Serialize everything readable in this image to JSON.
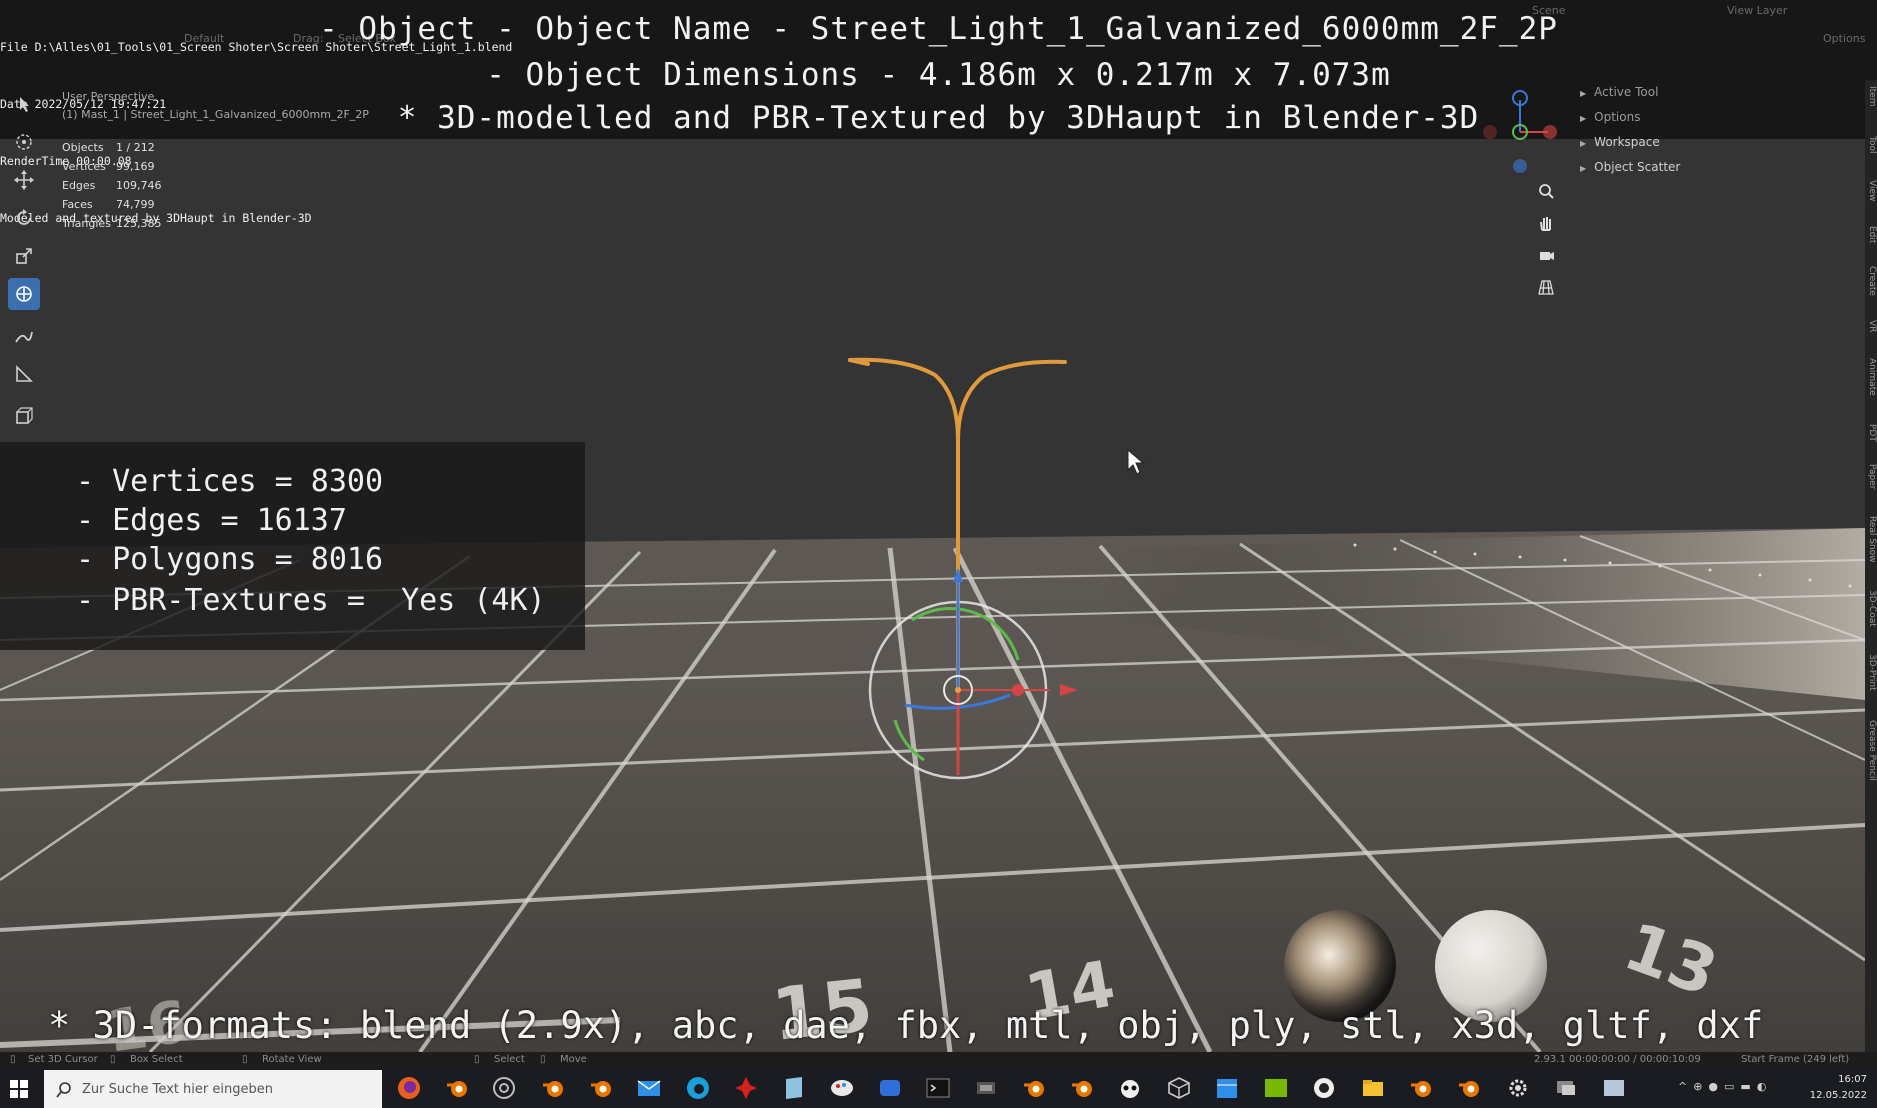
{
  "file_info": {
    "file": "File D:\\Alles\\01_Tools\\01_Screen Shoter\\Screen Shoter\\Street_Light_1.blend",
    "date": "Date 2022/05/12 19:47:21",
    "render_time": "RenderTime 00:00.08",
    "modeled_by": "Modeled and textured by 3DHaupt in Blender-3D"
  },
  "overlay_title": {
    "line1": "- Object - Object Name - Street_Light_1_Galvanized_6000mm_2F_2P",
    "line2": "- Object Dimensions -  4.186m x 0.217m x 7.073m",
    "line3": "* 3D-modelled and PBR-Textured by 3DHaupt in Blender-3D"
  },
  "top_faded": {
    "default": "Default",
    "drag": "Drag:",
    "select_box": "Select Box",
    "scene": "Scene",
    "view_layer": "View Layer",
    "options": "Options"
  },
  "viewport_header": {
    "perspective": "User Perspective",
    "collection": "(1) Mast_1 | Street_Light_1_Galvanized_6000mm_2F_2P"
  },
  "stats": [
    {
      "label": "Objects",
      "value": "1 / 212"
    },
    {
      "label": "Vertices",
      "value": "99,169"
    },
    {
      "label": "Edges",
      "value": "109,746"
    },
    {
      "label": "Faces",
      "value": "74,799"
    },
    {
      "label": "Triangles",
      "value": "125,385"
    }
  ],
  "info_box": {
    "vertices": "- Vertices = 8300",
    "edges": "- Edges = 16137",
    "polygons": "- Polygons = 8016",
    "pbr": "- PBR-Textures =  Yes (4K)"
  },
  "outliner": {
    "active_tool": "Active Tool",
    "options": "Options",
    "workspace": "Workspace",
    "object_scatter": "Object Scatter"
  },
  "right_tabs": [
    "Item",
    "Tool",
    "View",
    "Edit",
    "Create",
    "VR",
    "Animate",
    "PDT",
    "Paper",
    "Real Snow",
    "3D-Coat",
    "3D-Print",
    "Grease Pencil"
  ],
  "floor_numbers": {
    "n15": "15",
    "n14": "14",
    "n13": "13"
  },
  "formats": "* 3D-formats: blend (2.9x), abc, dae, fbx, mtl, obj, ply, stl, x3d, gltf, dxf",
  "statusbar": {
    "set_cursor": "Set 3D Cursor",
    "box_select": "Box Select",
    "rotate_view": "Rotate View",
    "select": "Select",
    "move": "Move",
    "version": "2.93.1  00:00:00:00 / 00:00:10:09",
    "start_frame": "Start Frame (249 left)"
  },
  "taskbar": {
    "search_placeholder": "Zur Suche Text hier eingeben",
    "time": "16:07",
    "date": "12.05.2022"
  },
  "colors": {
    "accent": "#3b6fb0",
    "object_outline": "#e8a040",
    "viewport_bg": "#303030"
  }
}
